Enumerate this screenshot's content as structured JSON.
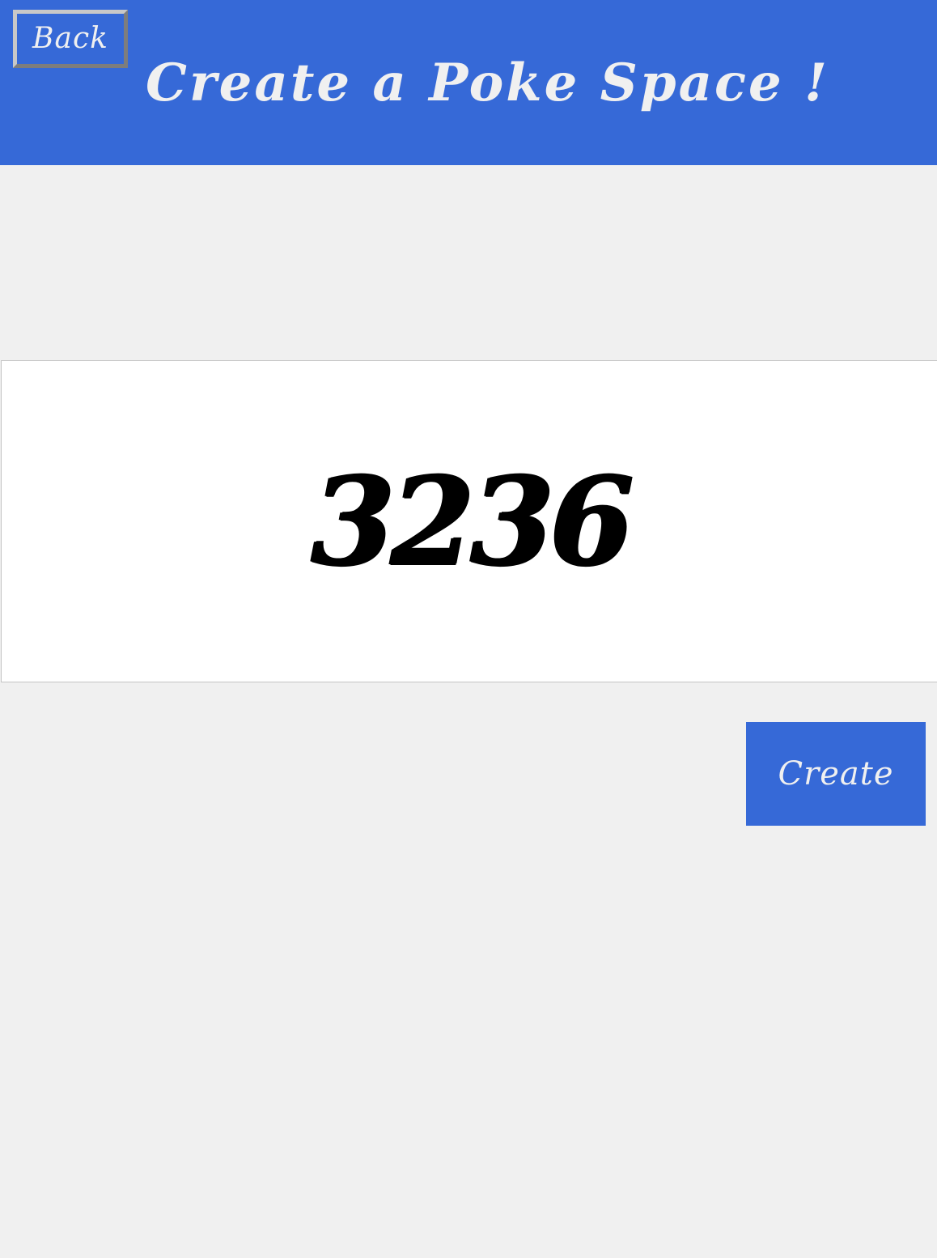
{
  "header": {
    "back_label": "Back",
    "title": "Create a Poke Space !"
  },
  "code_panel": {
    "code": "3236"
  },
  "actions": {
    "create_label": "Create"
  },
  "colors": {
    "primary_blue": "#3669d7",
    "background": "#f0f0f0",
    "panel": "#ffffff",
    "header_text": "#f0f0f0",
    "code_text": "#000000"
  }
}
